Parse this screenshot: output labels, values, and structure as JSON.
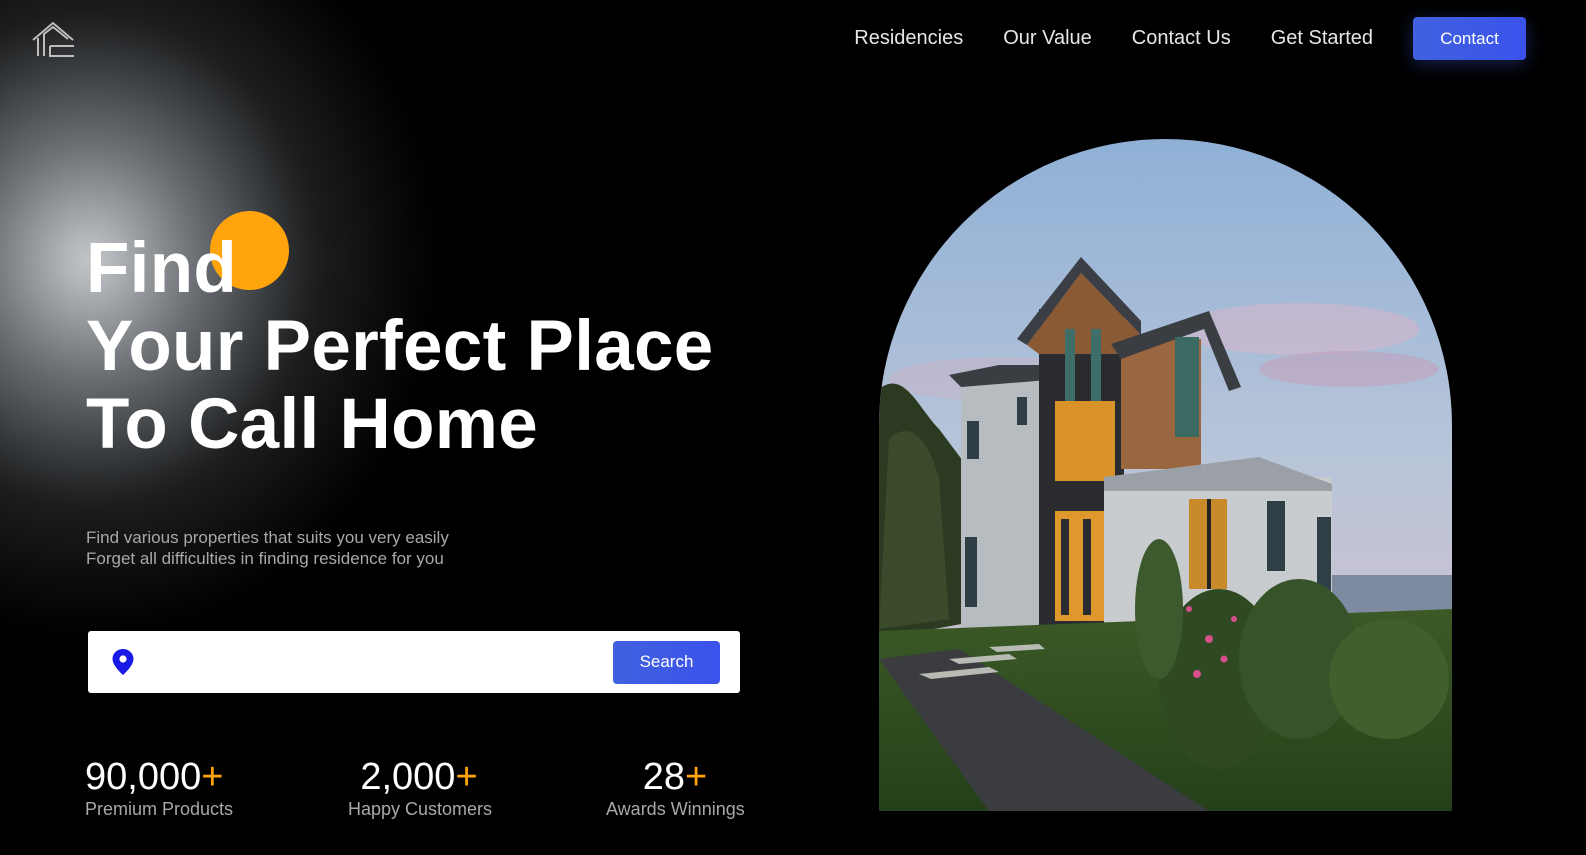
{
  "nav": {
    "logo_icon": "house-logo-icon",
    "links": [
      "Residencies",
      "Our Value",
      "Contact Us",
      "Get Started"
    ],
    "contact_label": "Contact"
  },
  "hero": {
    "title_lines": [
      "Find",
      "Your Perfect Place",
      "To Call Home"
    ],
    "description_lines": [
      "Find various properties that suits you very easily",
      "Forget all difficulties in finding residence for you"
    ]
  },
  "search": {
    "icon": "location-pin-icon",
    "value": "",
    "placeholder": "",
    "button_label": "Search"
  },
  "stats": [
    {
      "value": "90,000",
      "suffix": "+",
      "label": "Premium Products"
    },
    {
      "value": "2,000",
      "suffix": "+",
      "label": "Happy Customers"
    },
    {
      "value": "28",
      "suffix": "+",
      "label": "Awards Winnings"
    }
  ],
  "colors": {
    "accent_blue": "#4161df",
    "accent_orange": "#ffa40c",
    "background": "#000000",
    "muted_text": "#a8a8a8"
  },
  "hero_image": {
    "icon": "modern-house-photo"
  }
}
